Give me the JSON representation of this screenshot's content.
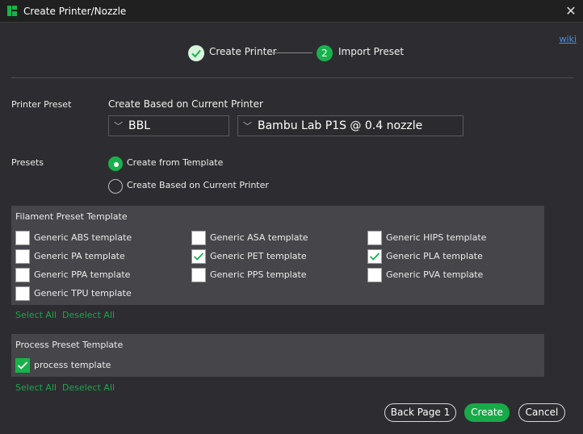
{
  "window": {
    "title": "Create Printer/Nozzle",
    "close_glyph": "✕",
    "accent_color": "#18b24b",
    "icons": {
      "logo": "app-logo-icon",
      "close": "close-icon",
      "check": "check-icon",
      "chevron": "chevron-down-icon"
    }
  },
  "wiki_link": "wiki",
  "steps": [
    {
      "label": "Create Printer",
      "state": "done"
    },
    {
      "number": "2",
      "label": "Import Preset",
      "state": "current"
    }
  ],
  "printer_preset": {
    "label": "Printer Preset",
    "heading": "Create Based on Current Printer",
    "vendor": "BBL",
    "model": "Bambu Lab P1S @ 0.4 nozzle",
    "chevron": "﹀"
  },
  "presets": {
    "label": "Presets",
    "options": [
      {
        "label": "Create from Template",
        "selected": true
      },
      {
        "label": "Create Based on Current Printer",
        "selected": false
      }
    ]
  },
  "filament_templates": {
    "title": "Filament Preset Template",
    "items": [
      {
        "label": "Generic ABS template",
        "checked": false
      },
      {
        "label": "Generic ASA template",
        "checked": false
      },
      {
        "label": "Generic HIPS template",
        "checked": false
      },
      {
        "label": "Generic PA template",
        "checked": false
      },
      {
        "label": "Generic PET template",
        "checked": true
      },
      {
        "label": "Generic PLA template",
        "checked": true
      },
      {
        "label": "Generic PPA template",
        "checked": false
      },
      {
        "label": "Generic PPS template",
        "checked": false
      },
      {
        "label": "Generic PVA template",
        "checked": false
      },
      {
        "label": "Generic TPU template",
        "checked": false
      }
    ],
    "select_all": "Select All",
    "deselect_all": "Deselect All"
  },
  "process_templates": {
    "title": "Process Preset Template",
    "items": [
      {
        "label": "process template",
        "checked": true
      }
    ],
    "select_all": "Select All",
    "deselect_all": "Deselect All"
  },
  "buttons": {
    "back": "Back Page 1",
    "create": "Create",
    "cancel": "Cancel"
  }
}
